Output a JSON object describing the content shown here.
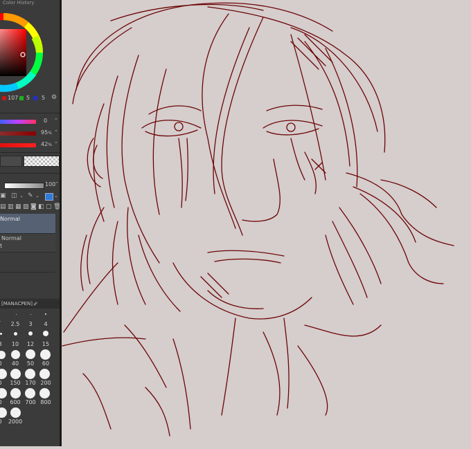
{
  "panel": {
    "title": "Color History",
    "color_values": {
      "r": "107",
      "g": "5",
      "b": "5"
    },
    "hsv": {
      "h": "0",
      "s": "95",
      "v": "42",
      "s_unit": "%",
      "v_unit": "%"
    },
    "opacity_value": "100",
    "blend_selected": "Normal",
    "blend_second": "Normal",
    "brush_tab": "[MANACPEN]",
    "brush_sizes_row1": [
      ".",
      "2.5",
      "3",
      "4"
    ],
    "brush_sizes_row2": [
      "8",
      "10",
      "12",
      "15"
    ],
    "brush_sizes_row3": [
      "0",
      "40",
      "50",
      "60"
    ],
    "brush_sizes_row4": [
      "0",
      "150",
      "170",
      "200"
    ],
    "brush_sizes_row5": [
      "0",
      "600",
      "700",
      "800"
    ],
    "brush_sizes_row6": [
      "0",
      "2000"
    ]
  },
  "colors": {
    "main": "#6b0505",
    "panel_bg": "#3b3b3b",
    "canvas_bg": "#d6cdcd",
    "selection": "#566174"
  },
  "icons": [
    "color-wheel-icon",
    "color-set-icon",
    "layer-icons",
    "trash-icon",
    "brush-tab-icon"
  ]
}
